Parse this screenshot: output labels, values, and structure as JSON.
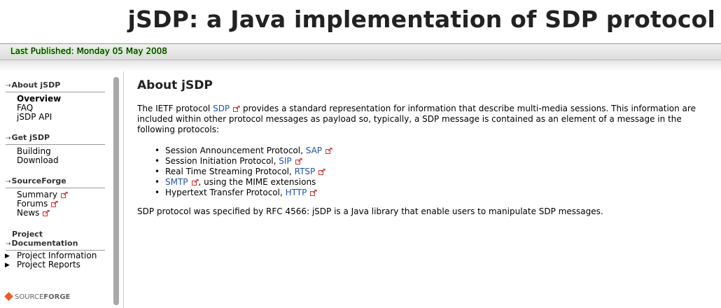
{
  "header": {
    "title": "jSDP: a Java implementation of SDP protocol",
    "published": "Last Published: Monday 05 May 2008"
  },
  "sidebar": {
    "sections": [
      {
        "title": "About jSDP",
        "items": [
          "Overview",
          "FAQ",
          "jSDP API"
        ]
      },
      {
        "title": "Get jSDP",
        "items": [
          "Building",
          "Download"
        ]
      },
      {
        "title": "SourceForge",
        "items": [
          "Summary",
          "Forums",
          "News"
        ]
      },
      {
        "title_line1": "Project",
        "title_line2": "Documentation",
        "items": [
          "Project Information",
          "Project Reports"
        ]
      }
    ],
    "logo": {
      "source": "SOURCE",
      "forge": "FORGE"
    }
  },
  "main": {
    "heading": "About jSDP",
    "intro_pre": "The IETF protocol ",
    "intro_link": "SDP",
    "intro_line1_post": " provides a standard representation for information that describe multi-media sessions. This information are",
    "intro_line2": "included within other protocol messages as payload so, typically, a SDP message is contained as an element of a message in the",
    "intro_line3": "following protocols:",
    "protocols": [
      {
        "pre": "Session Announcement Protocol, ",
        "link": "SAP",
        "post": ""
      },
      {
        "pre": "Session Initiation Protocol, ",
        "link": "SIP",
        "post": ""
      },
      {
        "pre": "Real Time Streaming Protocol, ",
        "link": "RTSP",
        "post": ""
      },
      {
        "pre": "",
        "link": "SMTP",
        "post": ", using the MIME extensions"
      },
      {
        "pre": "Hypertext Transfer Protocol, ",
        "link": "HTTP",
        "post": ""
      }
    ],
    "closing": "SDP protocol was specified by RFC 4566: jSDP is a Java library that enable users to manipulate SDP messages."
  },
  "colors": {
    "link": "#2255aa",
    "published_glow": "#8cff6a",
    "logo_orange": "#f05a28"
  }
}
